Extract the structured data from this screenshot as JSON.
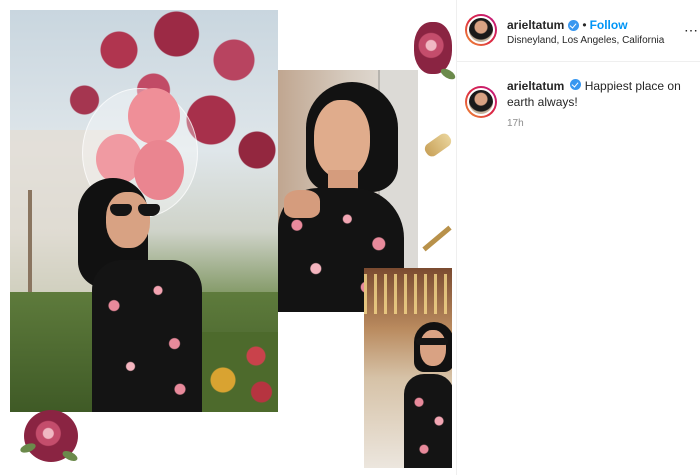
{
  "post": {
    "username": "arieltatum",
    "follow_label": "Follow",
    "separator": "•",
    "location": "Disneyland, Los Angeles, California",
    "caption": "Happiest place on earth always!",
    "time_ago": "17h"
  },
  "icons": {
    "verified": "verified-badge-icon",
    "more": "more-options-icon"
  },
  "colors": {
    "follow": "#0095f6",
    "verified": "#3897f0",
    "story_ring": [
      "#f09433",
      "#dc2743",
      "#bc1888"
    ]
  }
}
